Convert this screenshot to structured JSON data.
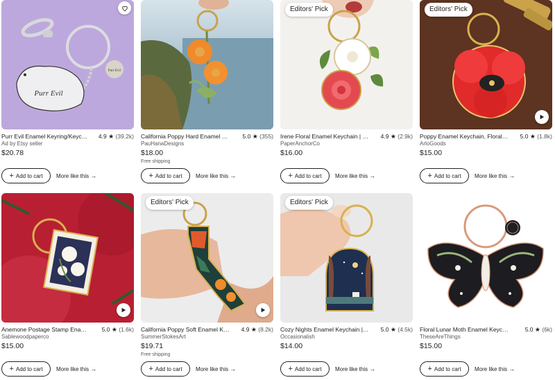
{
  "listings": [
    {
      "title": "Purr Evil Enamel Keyring/Keychain",
      "rating": "4.9",
      "review_count": "(39.2k)",
      "shop": "Ad by Etsy seller",
      "price": "$20.78",
      "shipping": "",
      "badge": "",
      "image_text": "Purr Evil",
      "tag_text": "Purr Evil",
      "add_to_cart": "Add to cart",
      "more_like_this": "More like this"
    },
    {
      "title": "California Poppy Hard Enamel Keychain",
      "rating": "5.0",
      "review_count": "(355)",
      "shop": "PauHanaDesigns",
      "price": "$18.00",
      "shipping": "Free shipping",
      "badge": "",
      "add_to_cart": "Add to cart",
      "more_like_this": "More like this"
    },
    {
      "title": "Irene Floral Enamel Keychain | Cute",
      "rating": "4.9",
      "review_count": "(2.9k)",
      "shop": "PaperAnchorCo",
      "price": "$16.00",
      "shipping": "",
      "badge": "Editors' Pick",
      "add_to_cart": "Add to cart",
      "more_like_this": "More like this"
    },
    {
      "title": "Poppy Enamel Keychain, Floral keychain",
      "rating": "5.0",
      "review_count": "(1.8k)",
      "shop": "ArloGoods",
      "price": "$15.00",
      "shipping": "",
      "badge": "Editors' Pick",
      "add_to_cart": "Add to cart",
      "more_like_this": "More like this"
    },
    {
      "title": "Anemone Postage Stamp Enamel Keychain",
      "rating": "5.0",
      "review_count": "(1.6k)",
      "shop": "Sablewoodpaperco",
      "price": "$15.00",
      "shipping": "",
      "badge": "",
      "add_to_cart": "Add to cart",
      "more_like_this": "More like this"
    },
    {
      "title": "California Poppy Soft Enamel Keychain",
      "rating": "4.9",
      "review_count": "(8.2k)",
      "shop": "SummerStokesArt",
      "price": "$19.71",
      "shipping": "Free shipping",
      "badge": "Editors' Pick",
      "add_to_cart": "Add to cart",
      "more_like_this": "More like this"
    },
    {
      "title": "Cozy Nights Enamel Keychain | Book",
      "rating": "5.0",
      "review_count": "(4.5k)",
      "shop": "Occasionalish",
      "price": "$14.00",
      "shipping": "",
      "badge": "Editors' Pick",
      "add_to_cart": "Add to cart",
      "more_like_this": "More like this"
    },
    {
      "title": "Floral Lunar Moth Enamel Keychain",
      "rating": "5.0",
      "review_count": "(6k)",
      "shop": "TheseAreThings",
      "price": "$15.00",
      "shipping": "",
      "badge": "",
      "add_to_cart": "Add to cart",
      "more_like_this": "More like this"
    }
  ],
  "icons": {
    "star": "★",
    "arrow": "→",
    "plus": "+",
    "favorite": "heart-icon",
    "video": "play-icon"
  },
  "colors": {
    "text": "#222222",
    "muted": "#595959",
    "button_border": "#222222"
  }
}
